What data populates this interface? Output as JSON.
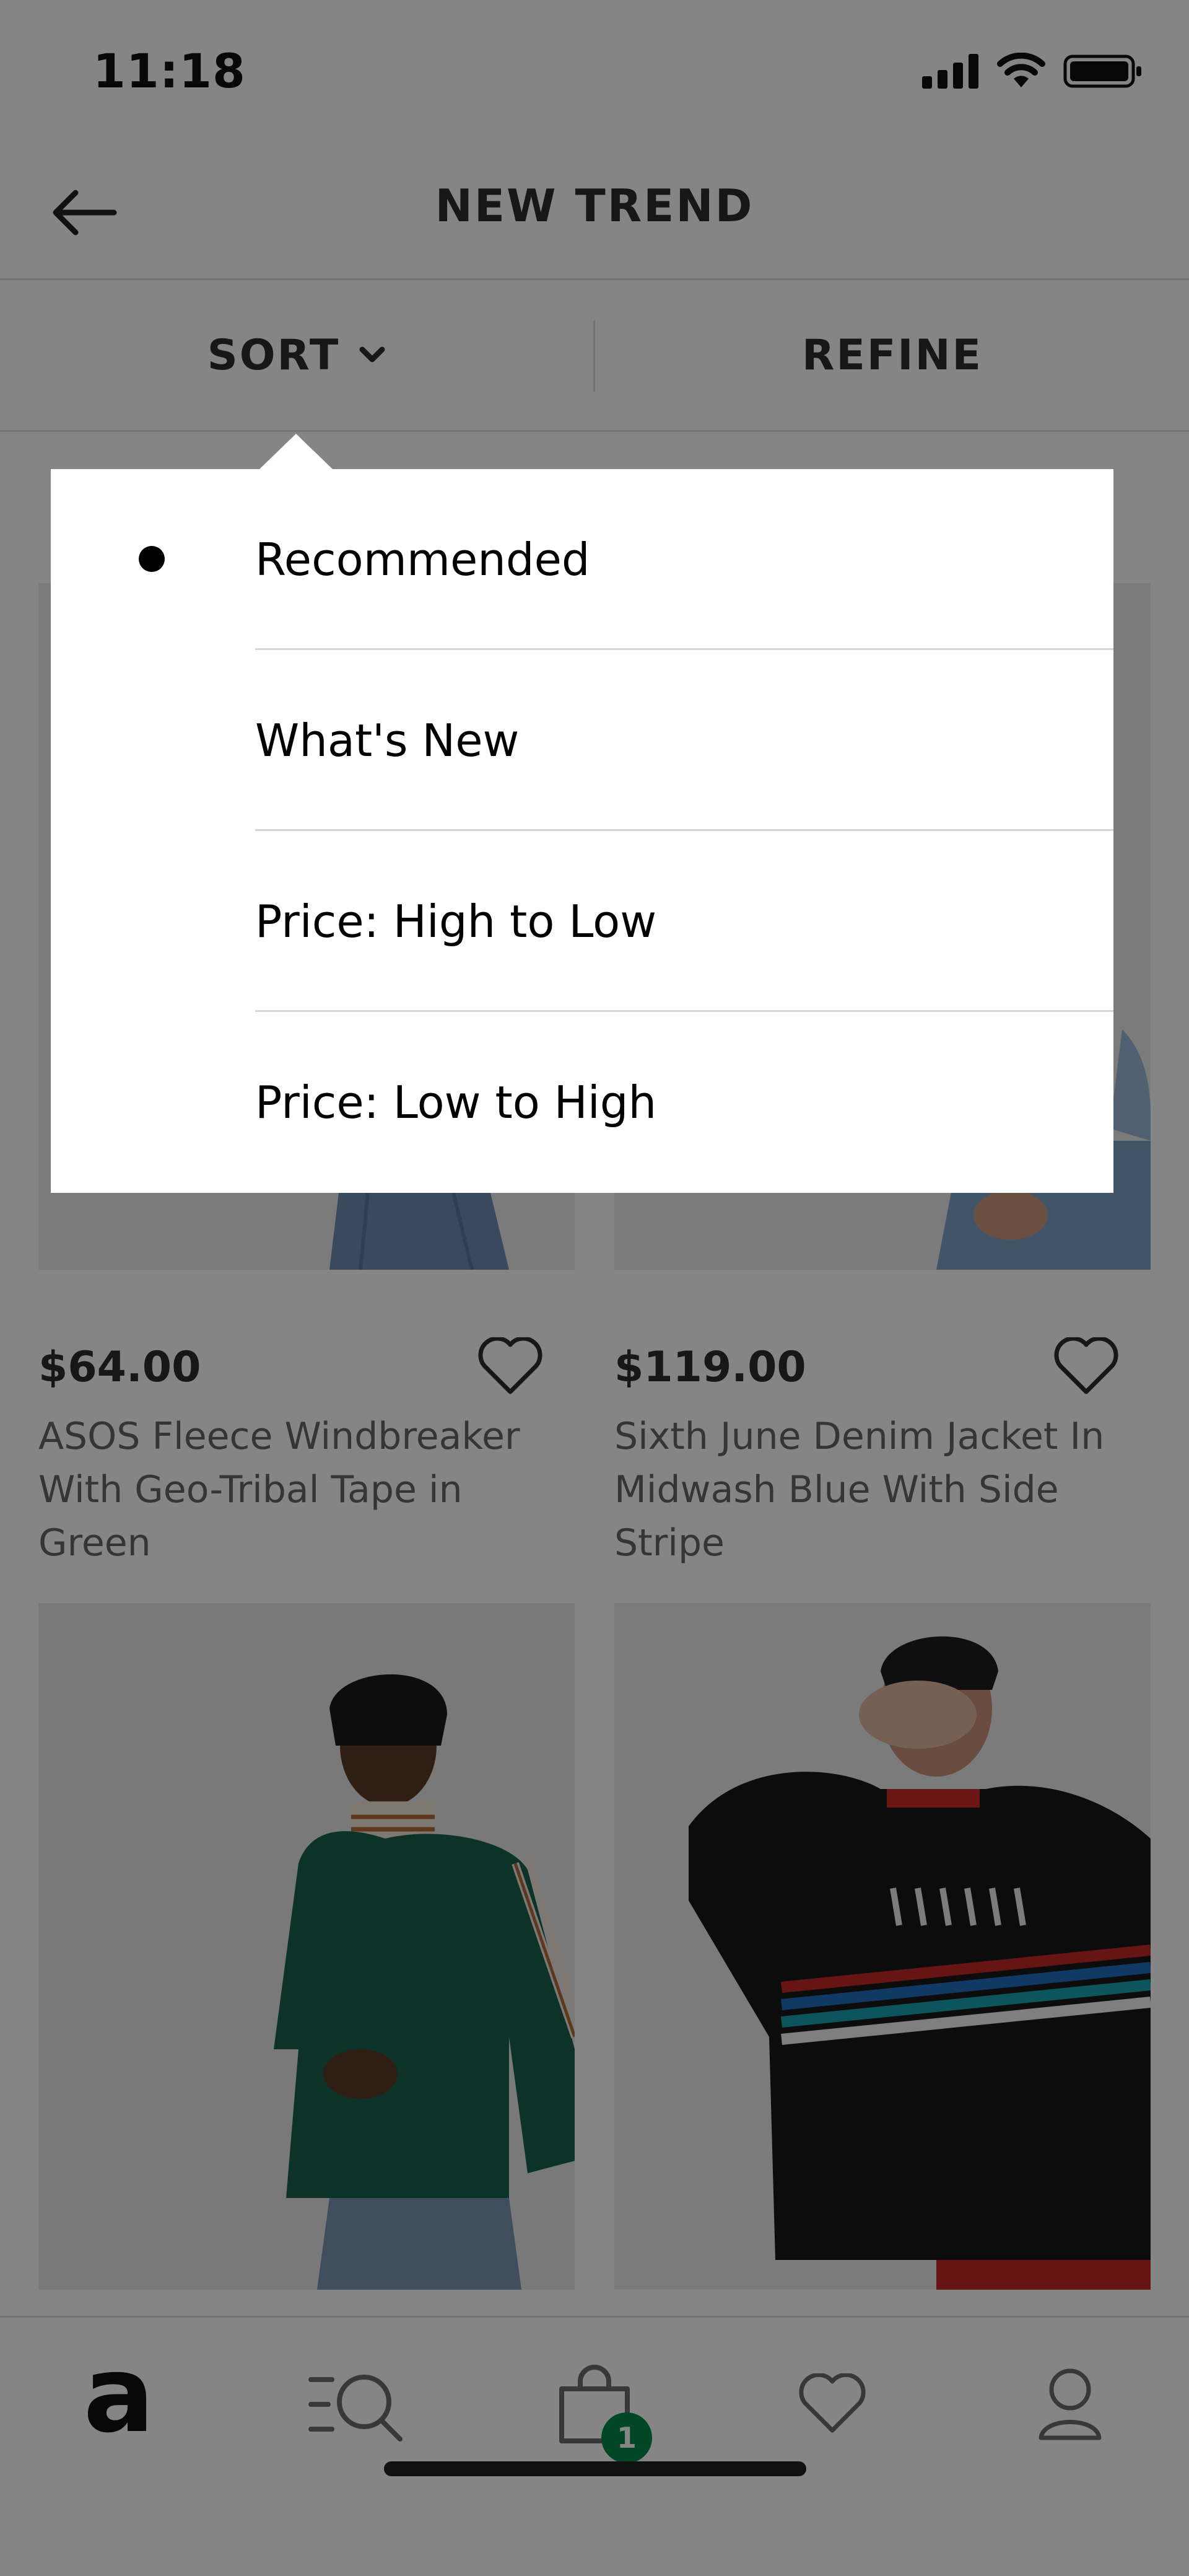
{
  "status_bar": {
    "time": "11:18"
  },
  "header": {
    "title": "NEW TREND"
  },
  "toolbar": {
    "sort_label": "SORT",
    "refine_label": "REFINE"
  },
  "sort_menu": {
    "selected_index": 0,
    "options": [
      "Recommended",
      "What's New",
      "Price: High to Low",
      "Price: Low to High"
    ]
  },
  "products": [
    {
      "price": "$64.00",
      "name": "ASOS Fleece Windbreaker With Geo-Tribal Tape in Green"
    },
    {
      "price": "$119.00",
      "name": "Sixth June Denim Jacket In Midwash Blue With Side Stripe"
    },
    {
      "price": "",
      "name": ""
    },
    {
      "price": "",
      "name": ""
    }
  ],
  "bottom_nav": {
    "home_logo": "a",
    "bag_count": "1",
    "items": [
      "home",
      "search",
      "bag",
      "saved",
      "account"
    ]
  },
  "colors": {
    "accent": "#018849",
    "overlay": "rgba(0,0,0,0.48)"
  }
}
